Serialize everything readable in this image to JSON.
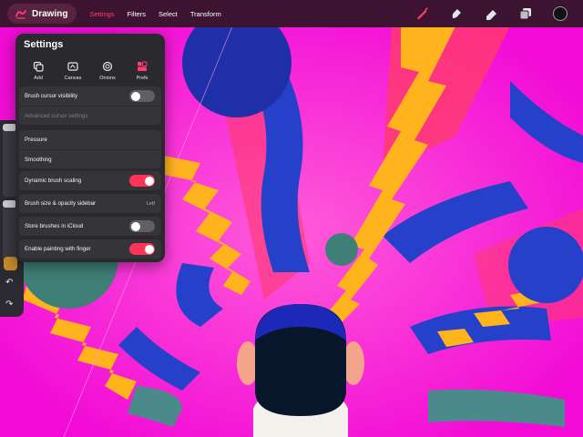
{
  "app": {
    "title": "Drawing"
  },
  "menu": [
    {
      "label": "Settings",
      "active": true
    },
    {
      "label": "Filters",
      "active": false
    },
    {
      "label": "Select",
      "active": false
    },
    {
      "label": "Transform",
      "active": false
    }
  ],
  "tools": {
    "brush": "brush-icon",
    "smudge": "smudge-icon",
    "eraser": "eraser-icon",
    "layers": "layers-icon",
    "color": "#101216"
  },
  "settings": {
    "title": "Settings",
    "tabs": [
      {
        "label": "Add",
        "icon": "add-icon"
      },
      {
        "label": "Canvas",
        "icon": "canvas-icon"
      },
      {
        "label": "Onions",
        "icon": "onion-skin-icon"
      },
      {
        "label": "Prefs",
        "icon": "prefs-icon"
      }
    ],
    "rows": {
      "brush_cursor_visibility": {
        "label": "Brush cursor visibility",
        "on": false
      },
      "advanced_cursor": {
        "label": "Advanced cursor settings"
      },
      "pressure": {
        "label": "Pressure"
      },
      "smoothing": {
        "label": "Smoothing"
      },
      "dynamic_scaling": {
        "label": "Dynamic brush scaling",
        "on": true
      },
      "sidebar": {
        "label": "Brush size & opacity sidebar",
        "value": "Left"
      },
      "icloud": {
        "label": "Store brushes in iCloud",
        "on": false
      },
      "finger": {
        "label": "Enable painting with finger",
        "on": true
      }
    }
  },
  "colors": {
    "accent": "#ff3d6e",
    "toggle_on": "#ff3358",
    "canvas_bg": "#f20bd6"
  }
}
